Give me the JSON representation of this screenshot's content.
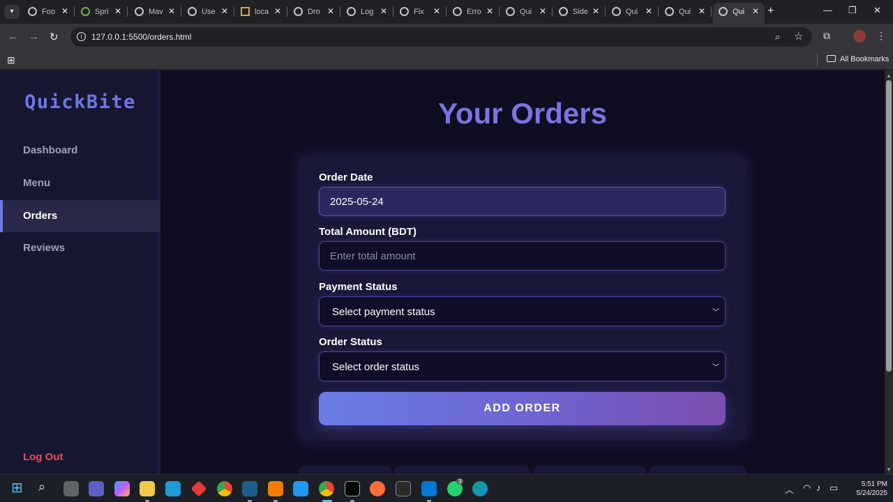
{
  "browser": {
    "tabs": [
      {
        "title": "Foo"
      },
      {
        "title": "Spri"
      },
      {
        "title": "Mav"
      },
      {
        "title": "Use"
      },
      {
        "title": "loca"
      },
      {
        "title": "Dro"
      },
      {
        "title": "Log"
      },
      {
        "title": "Fix"
      },
      {
        "title": "Erro"
      },
      {
        "title": "Qui"
      },
      {
        "title": "Side"
      },
      {
        "title": "Qui"
      },
      {
        "title": "Qui"
      },
      {
        "title": "Qui"
      }
    ],
    "url": "127.0.0.1:5500/orders.html",
    "bookmarks_all": "All Bookmarks"
  },
  "sidebar": {
    "logo": "QuickBite",
    "items": [
      {
        "label": "Dashboard"
      },
      {
        "label": "Menu"
      },
      {
        "label": "Orders"
      },
      {
        "label": "Reviews"
      }
    ],
    "active_item": "Orders",
    "logout": "Log Out"
  },
  "main": {
    "title": "Your Orders",
    "form": {
      "order_date_label": "Order Date",
      "order_date_value": "2025-05-24",
      "total_amount_label": "Total Amount (BDT)",
      "total_amount_placeholder": "Enter total amount",
      "payment_status_label": "Payment Status",
      "payment_status_selected": "Select payment status",
      "order_status_label": "Order Status",
      "order_status_selected": "Select order status",
      "submit_label": "ADD ORDER"
    }
  },
  "taskbar": {
    "time": "5:51 PM",
    "date": "5/24/2025",
    "whatsapp_badge": "3"
  },
  "colors": {
    "accent": "#6d78e6",
    "title": "#7b73de",
    "page_bg": "#0e0d22",
    "sidebar_bg": "#171631",
    "logout": "#e54d5a"
  }
}
